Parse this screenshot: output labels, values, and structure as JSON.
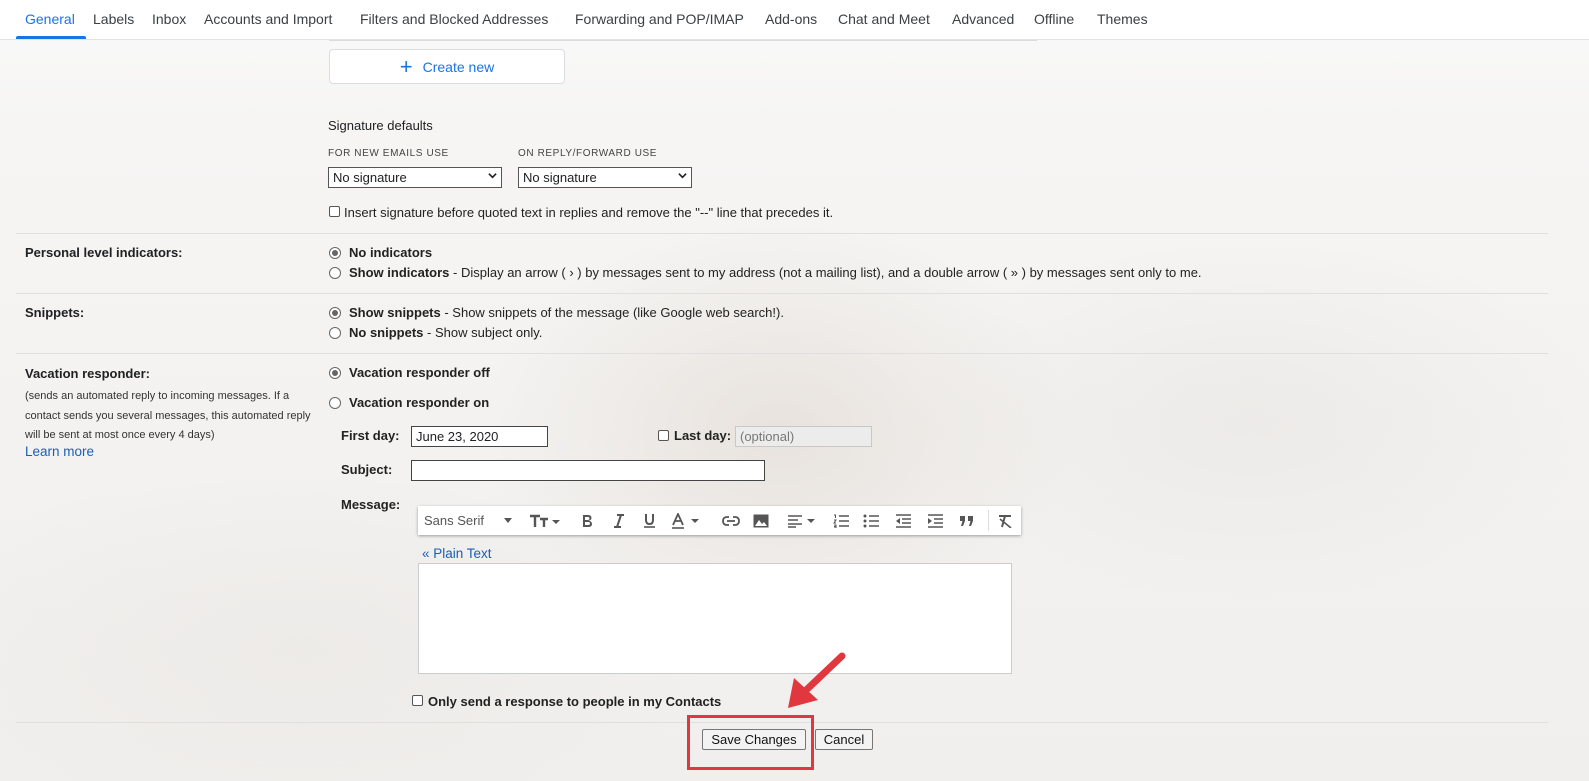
{
  "tabs": [
    {
      "label": "General",
      "active": true
    },
    {
      "label": "Labels"
    },
    {
      "label": "Inbox"
    },
    {
      "label": "Accounts and Import"
    },
    {
      "label": "Filters and Blocked Addresses"
    },
    {
      "label": "Forwarding and POP/IMAP"
    },
    {
      "label": "Add-ons"
    },
    {
      "label": "Chat and Meet"
    },
    {
      "label": "Advanced"
    },
    {
      "label": "Offline"
    },
    {
      "label": "Themes"
    }
  ],
  "signature": {
    "create_new": "Create new",
    "defaults_title": "Signature defaults",
    "new_emails_label": "FOR NEW EMAILS USE",
    "new_emails_value": "No signature",
    "reply_label": "ON REPLY/FORWARD USE",
    "reply_value": "No signature",
    "insert_before": "Insert signature before quoted text in replies and remove the \"--\" line that precedes it."
  },
  "personal_level": {
    "title": "Personal level indicators:",
    "option1_bold": "No indicators",
    "option2_bold": "Show indicators",
    "option2_desc": " - Display an arrow ( › ) by messages sent to my address (not a mailing list), and a double arrow ( » ) by messages sent only to me.",
    "selected": "No indicators"
  },
  "snippets": {
    "title": "Snippets:",
    "option1_bold": "Show snippets",
    "option1_desc": " - Show snippets of the message (like Google web search!).",
    "option2_bold": "No snippets",
    "option2_desc": " - Show subject only.",
    "selected": "Show snippets"
  },
  "vacation": {
    "title": "Vacation responder:",
    "note": "(sends an automated reply to incoming messages. If a contact sends you several messages, this automated reply will be sent at most once every 4 days)",
    "learn_more": "Learn more",
    "off_label": "Vacation responder off",
    "on_label": "Vacation responder on",
    "selected": "Vacation responder off",
    "first_day_label": "First day:",
    "first_day_value": "June 23, 2020",
    "last_day_label": "Last day:",
    "last_day_placeholder": "(optional)",
    "subject_label": "Subject:",
    "subject_value": "",
    "message_label": "Message:",
    "font_name": "Sans Serif",
    "plain_text": "« Plain Text",
    "contacts_only": "Only send a response to people in my Contacts"
  },
  "actions": {
    "save": "Save Changes",
    "cancel": "Cancel"
  },
  "colors": {
    "accent": "#1a73e8",
    "link": "#1a5fb4",
    "highlight": "#e0383e"
  }
}
